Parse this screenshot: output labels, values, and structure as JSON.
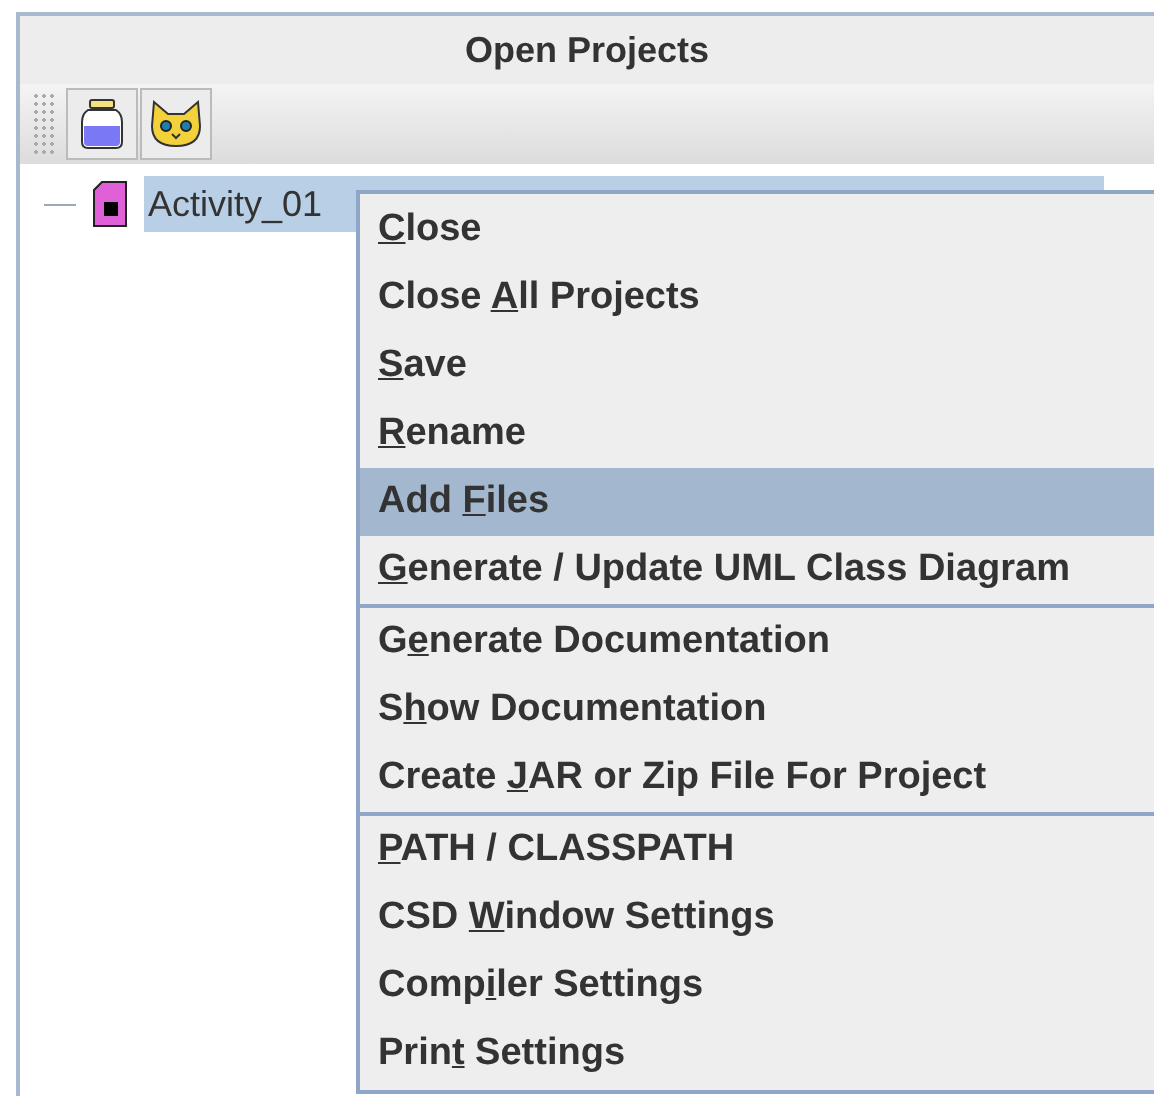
{
  "panel": {
    "title": "Open Projects"
  },
  "toolbar": [
    {
      "kind": "jar"
    },
    {
      "kind": "cat"
    }
  ],
  "tree": [
    {
      "label": "Activity_01",
      "selected": true
    }
  ],
  "menu": {
    "groups": [
      [
        {
          "key": "C",
          "after": "lose",
          "selected": false
        },
        {
          "before": "Close ",
          "key": "A",
          "after": "ll Projects",
          "selected": false
        },
        {
          "key": "S",
          "after": "ave",
          "selected": false
        },
        {
          "key": "R",
          "after": "ename",
          "selected": false
        },
        {
          "before": "Add ",
          "key": "F",
          "after": "iles",
          "selected": true
        },
        {
          "key": "G",
          "after": "enerate / Update UML Class Diagram",
          "selected": false
        }
      ],
      [
        {
          "before": "G",
          "key": "e",
          "after": "nerate Documentation",
          "selected": false
        },
        {
          "before": "S",
          "key": "h",
          "after": "ow Documentation",
          "selected": false
        },
        {
          "before": "Create ",
          "key": "J",
          "after": "AR or Zip File For Project",
          "selected": false
        }
      ],
      [
        {
          "key": "P",
          "after": "ATH / CLASSPATH",
          "selected": false
        },
        {
          "before": "CSD ",
          "key": "W",
          "after": "indow Settings",
          "selected": false
        },
        {
          "before": "Comp",
          "key": "i",
          "after": "ler Settings",
          "selected": false
        },
        {
          "before": "Prin",
          "key": "t",
          "after": " Settings",
          "selected": false
        }
      ]
    ]
  }
}
